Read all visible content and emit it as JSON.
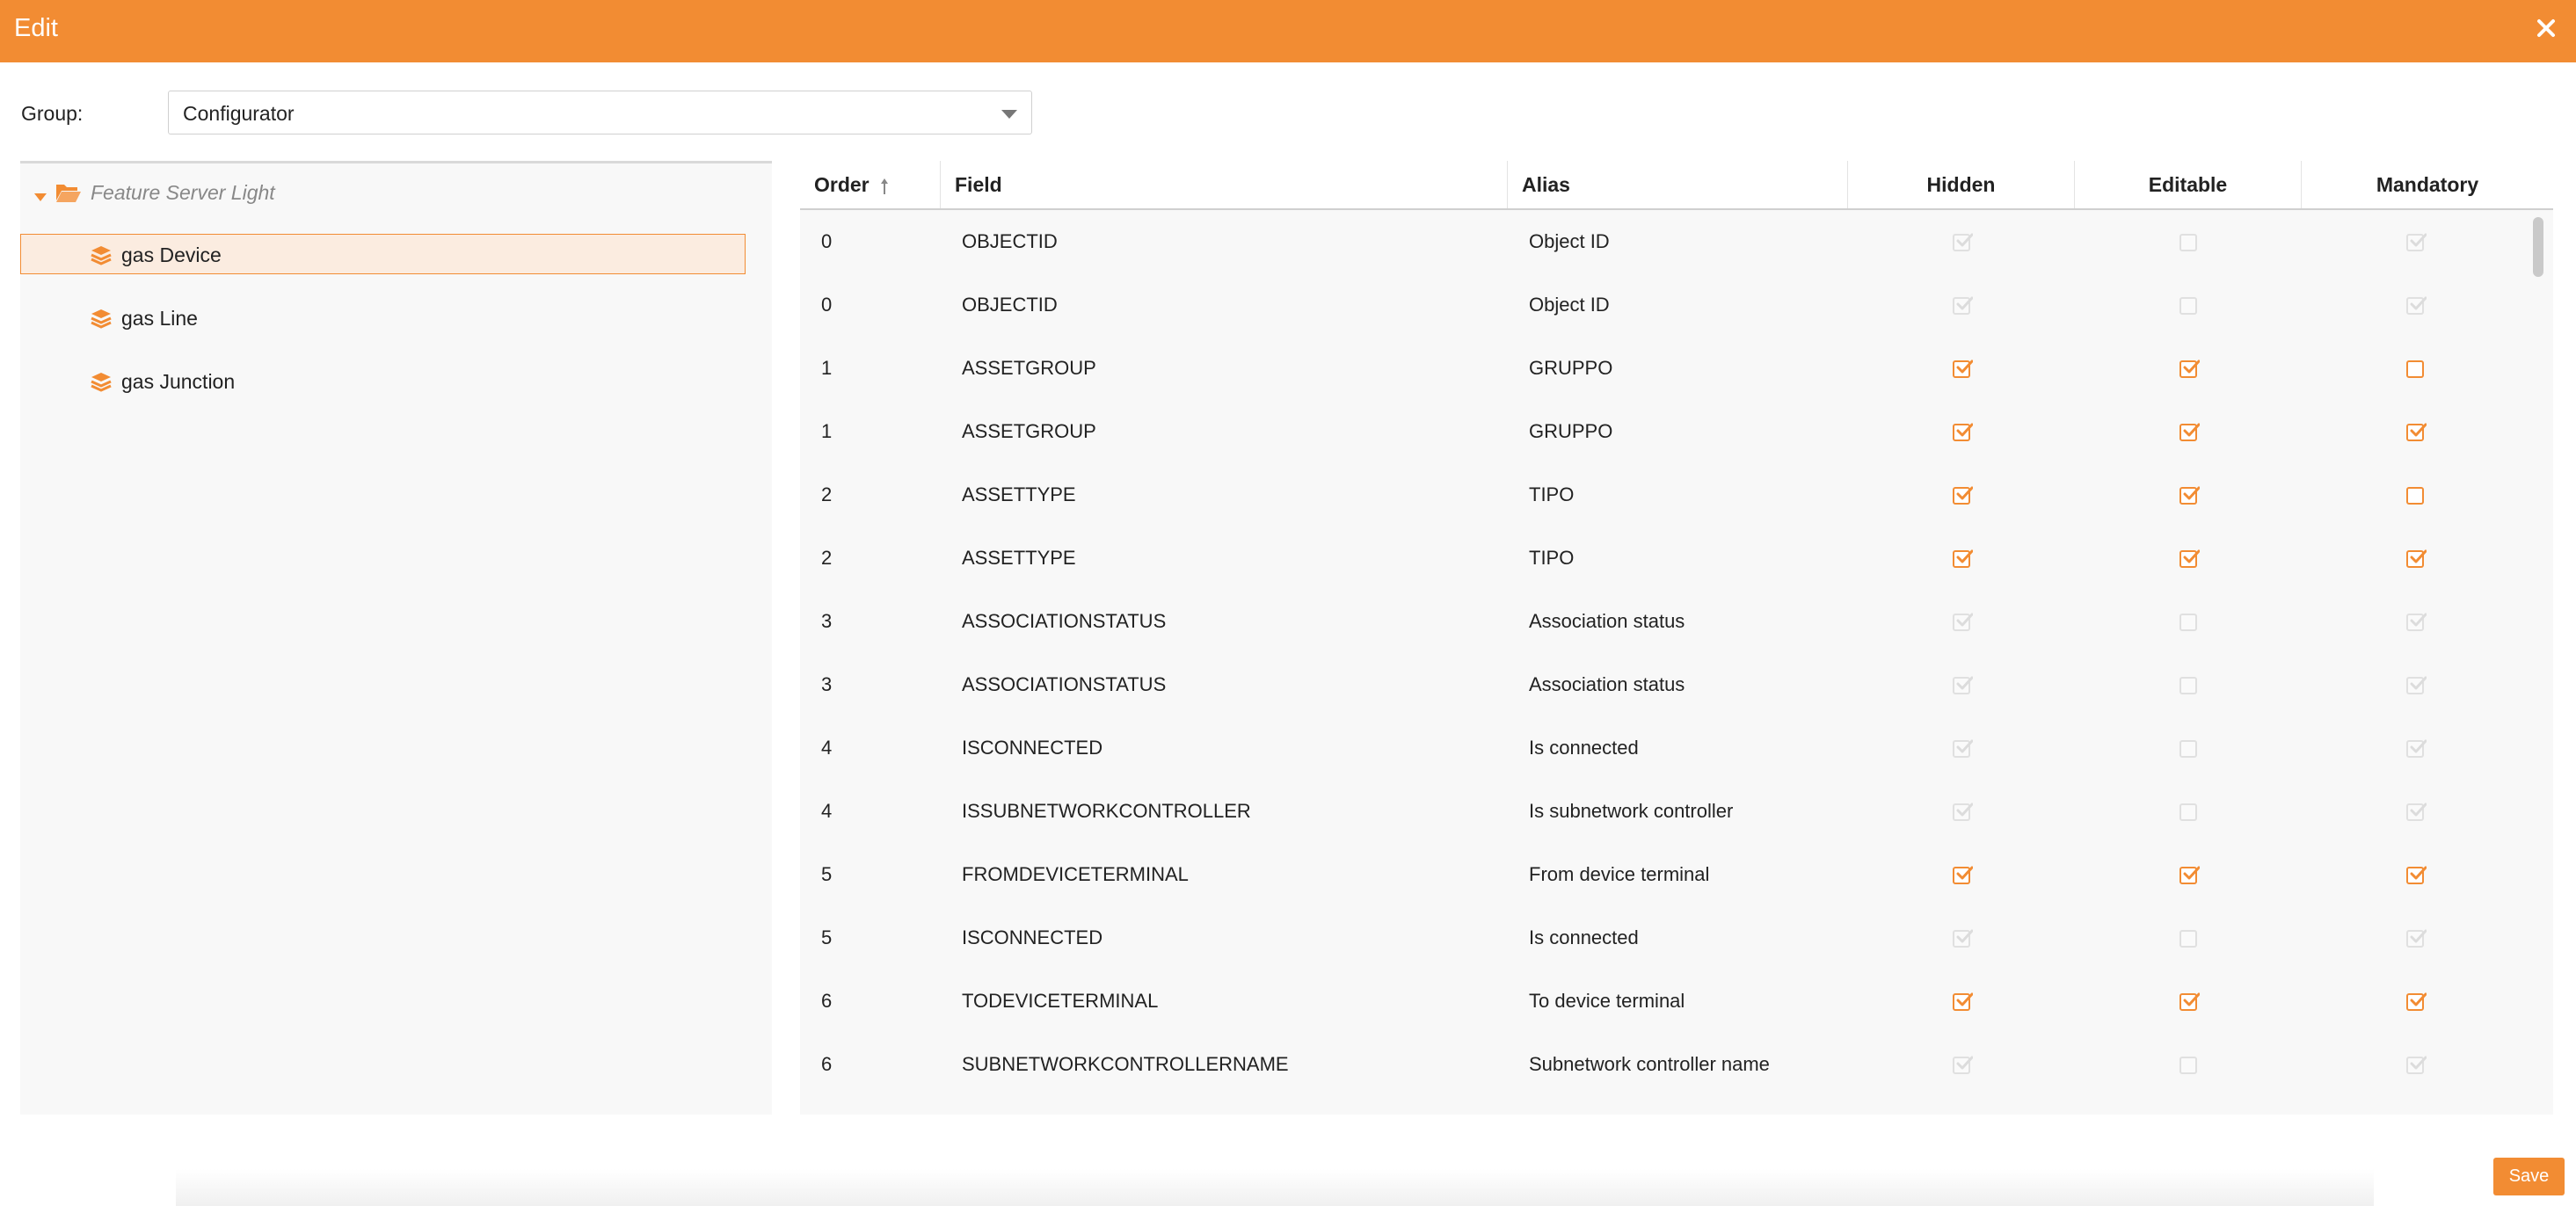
{
  "dialog": {
    "title": "Edit",
    "close_icon": "close-icon",
    "accent_color": "#f28c33"
  },
  "group": {
    "label": "Group:",
    "value": "Configurator"
  },
  "tree": {
    "root": {
      "label": "Feature Server Light",
      "icon": "folder-open-icon"
    },
    "items": [
      {
        "label": "gas Device",
        "icon": "layers-icon",
        "selected": true
      },
      {
        "label": "gas Line",
        "icon": "layers-icon",
        "selected": false
      },
      {
        "label": "gas Junction",
        "icon": "layers-icon",
        "selected": false
      }
    ]
  },
  "table": {
    "columns": [
      "Order",
      "Field",
      "Alias",
      "Hidden",
      "Editable",
      "Mandatory"
    ],
    "sort_icon": "sort-ascending-icon",
    "rows": [
      {
        "order": "0",
        "field": "OBJECTID",
        "alias": "Object ID",
        "hidden": true,
        "editable": false,
        "mandatory": true,
        "locked": true
      },
      {
        "order": "0",
        "field": "OBJECTID",
        "alias": "Object ID",
        "hidden": true,
        "editable": false,
        "mandatory": true,
        "locked": true
      },
      {
        "order": "1",
        "field": "ASSETGROUP",
        "alias": "GRUPPO",
        "hidden": true,
        "editable": true,
        "mandatory": false,
        "locked": false
      },
      {
        "order": "1",
        "field": "ASSETGROUP",
        "alias": "GRUPPO",
        "hidden": true,
        "editable": true,
        "mandatory": true,
        "locked": false
      },
      {
        "order": "2",
        "field": "ASSETTYPE",
        "alias": "TIPO",
        "hidden": true,
        "editable": true,
        "mandatory": false,
        "locked": false
      },
      {
        "order": "2",
        "field": "ASSETTYPE",
        "alias": "TIPO",
        "hidden": true,
        "editable": true,
        "mandatory": true,
        "locked": false
      },
      {
        "order": "3",
        "field": "ASSOCIATIONSTATUS",
        "alias": "Association status",
        "hidden": true,
        "editable": false,
        "mandatory": true,
        "locked": true
      },
      {
        "order": "3",
        "field": "ASSOCIATIONSTATUS",
        "alias": "Association status",
        "hidden": true,
        "editable": false,
        "mandatory": true,
        "locked": true
      },
      {
        "order": "4",
        "field": "ISCONNECTED",
        "alias": "Is connected",
        "hidden": true,
        "editable": false,
        "mandatory": true,
        "locked": true
      },
      {
        "order": "4",
        "field": "ISSUBNETWORKCONTROLLER",
        "alias": "Is subnetwork controller",
        "hidden": true,
        "editable": false,
        "mandatory": true,
        "locked": true
      },
      {
        "order": "5",
        "field": "FROMDEVICETERMINAL",
        "alias": "From device terminal",
        "hidden": true,
        "editable": true,
        "mandatory": true,
        "locked": false
      },
      {
        "order": "5",
        "field": "ISCONNECTED",
        "alias": "Is connected",
        "hidden": true,
        "editable": false,
        "mandatory": true,
        "locked": true
      },
      {
        "order": "6",
        "field": "TODEVICETERMINAL",
        "alias": "To device terminal",
        "hidden": true,
        "editable": true,
        "mandatory": true,
        "locked": false
      },
      {
        "order": "6",
        "field": "SUBNETWORKCONTROLLERNAME",
        "alias": "Subnetwork controller name",
        "hidden": true,
        "editable": false,
        "mandatory": true,
        "locked": true
      }
    ]
  },
  "footer": {
    "save_label": "Save"
  }
}
